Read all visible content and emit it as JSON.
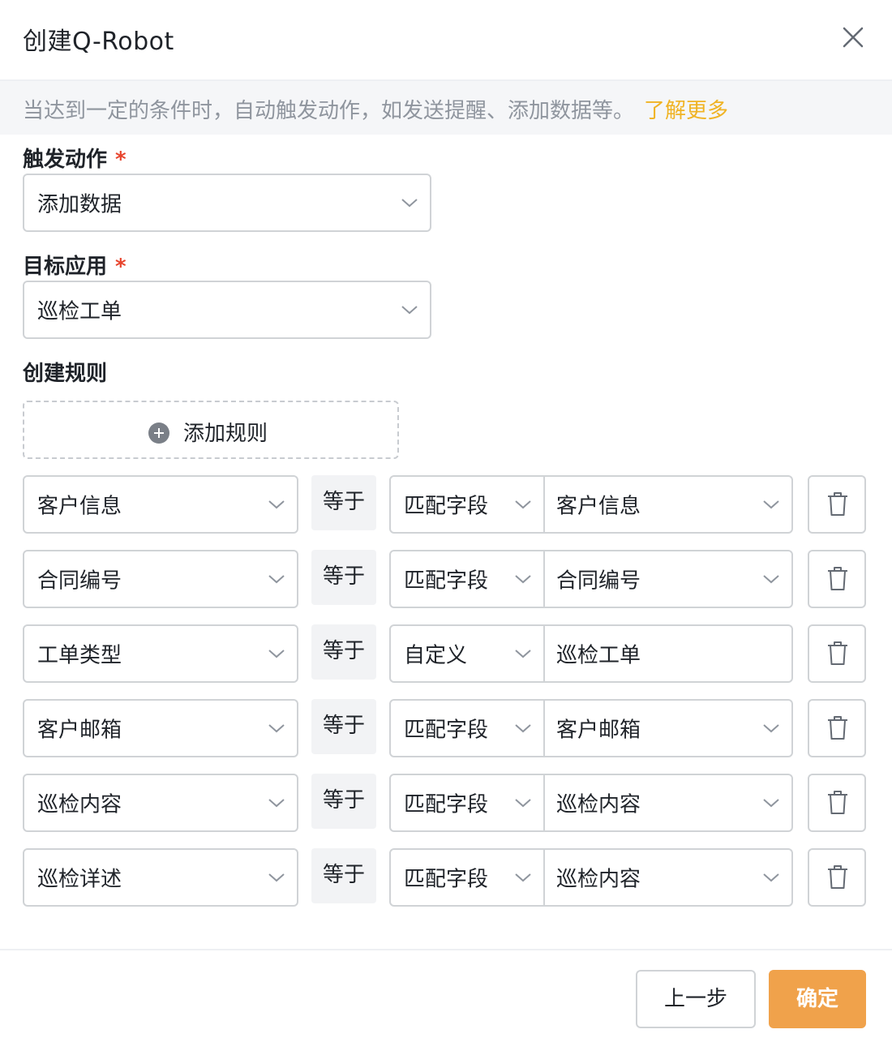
{
  "dialog": {
    "title": "创建Q-Robot",
    "description": "当达到一定的条件时，自动触发动作，如发送提醒、添加数据等。",
    "learn_more": "了解更多"
  },
  "form": {
    "trigger_action": {
      "label": "触发动作",
      "required_mark": "*",
      "value": "添加数据"
    },
    "target_app": {
      "label": "目标应用",
      "required_mark": "*",
      "value": "巡检工单"
    },
    "create_rules": {
      "label": "创建规则",
      "add_rule_label": "添加规则"
    }
  },
  "rules": [
    {
      "field": "客户信息",
      "operator": "等于",
      "mode": "匹配字段",
      "target": "客户信息",
      "target_dropdown": true
    },
    {
      "field": "合同编号",
      "operator": "等于",
      "mode": "匹配字段",
      "target": "合同编号",
      "target_dropdown": true
    },
    {
      "field": "工单类型",
      "operator": "等于",
      "mode": "自定义",
      "target": "巡检工单",
      "target_dropdown": false
    },
    {
      "field": "客户邮箱",
      "operator": "等于",
      "mode": "匹配字段",
      "target": "客户邮箱",
      "target_dropdown": true
    },
    {
      "field": "巡检内容",
      "operator": "等于",
      "mode": "匹配字段",
      "target": "巡检内容",
      "target_dropdown": true
    },
    {
      "field": "巡检详述",
      "operator": "等于",
      "mode": "匹配字段",
      "target": "巡检内容",
      "target_dropdown": true
    }
  ],
  "footer": {
    "prev_label": "上一步",
    "confirm_label": "确定"
  },
  "colors": {
    "accent": "#f0a24b",
    "link": "#f0b323",
    "required": "#e8442d",
    "border": "#d0d3d6"
  },
  "icons": {
    "close": "close-icon",
    "dropdown": "chevron-down-icon",
    "add": "plus-circle-icon",
    "delete": "trash-icon"
  }
}
